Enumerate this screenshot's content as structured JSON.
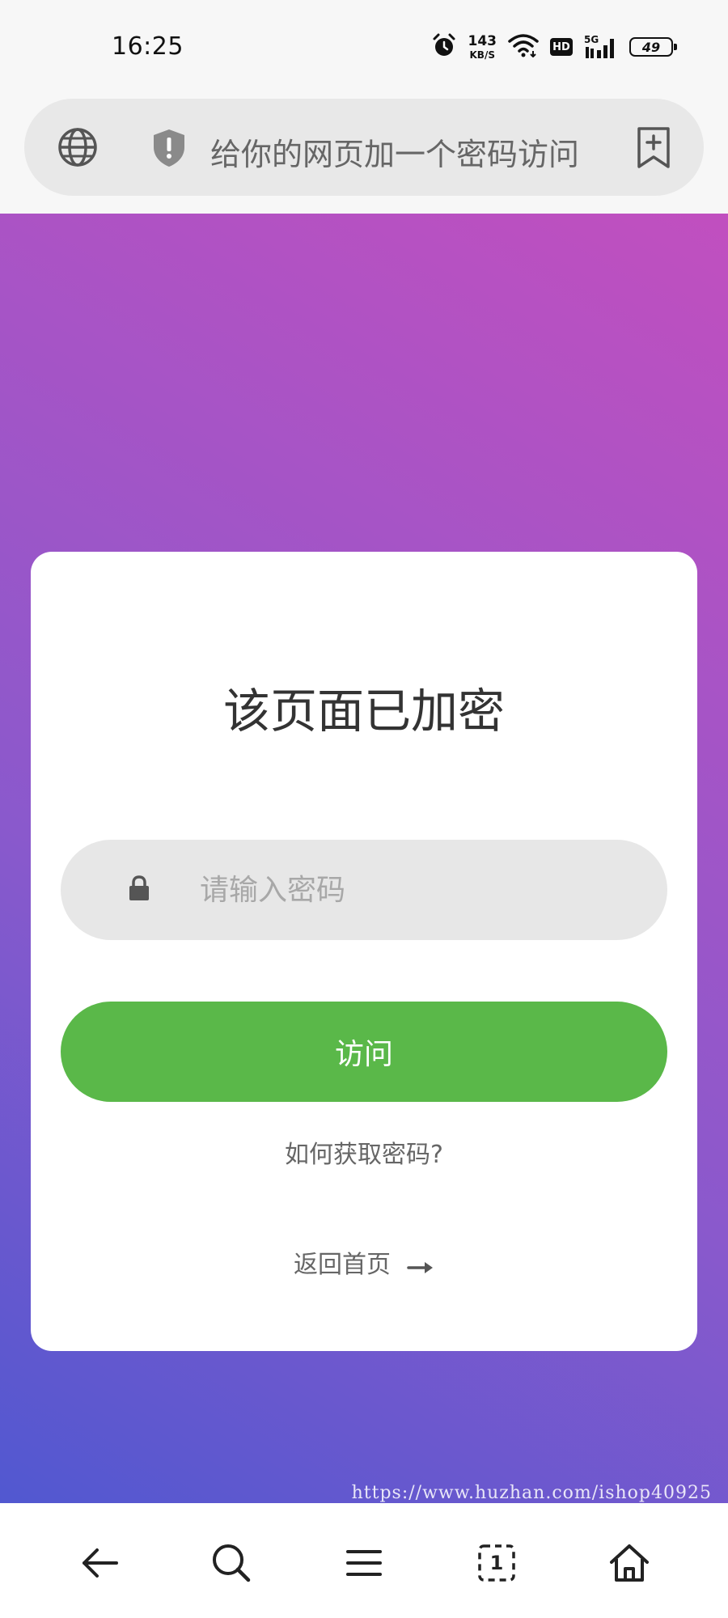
{
  "status_bar": {
    "time": "16:25",
    "net_speed_value": "143",
    "net_speed_unit": "KB/S",
    "hd_label": "HD",
    "network_type": "5G",
    "battery_level": "49"
  },
  "address_bar": {
    "page_title": "给你的网页加一个密码访问"
  },
  "card": {
    "title": "该页面已加密",
    "password_placeholder": "请输入密码",
    "password_value": "",
    "visit_button_label": "访问",
    "help_link": "如何获取密码?",
    "home_link": "返回首页"
  },
  "watermark": "https://www.huzhan.com/ishop40925",
  "bottom_nav": {
    "items": [
      "back-icon",
      "search-icon",
      "menu-icon",
      "tabs-icon",
      "home-icon"
    ],
    "tab_count": "1"
  },
  "colors": {
    "accent_green": "#5ab849",
    "gradient_top": "#c14fbf",
    "gradient_bottom": "#5158d0"
  }
}
